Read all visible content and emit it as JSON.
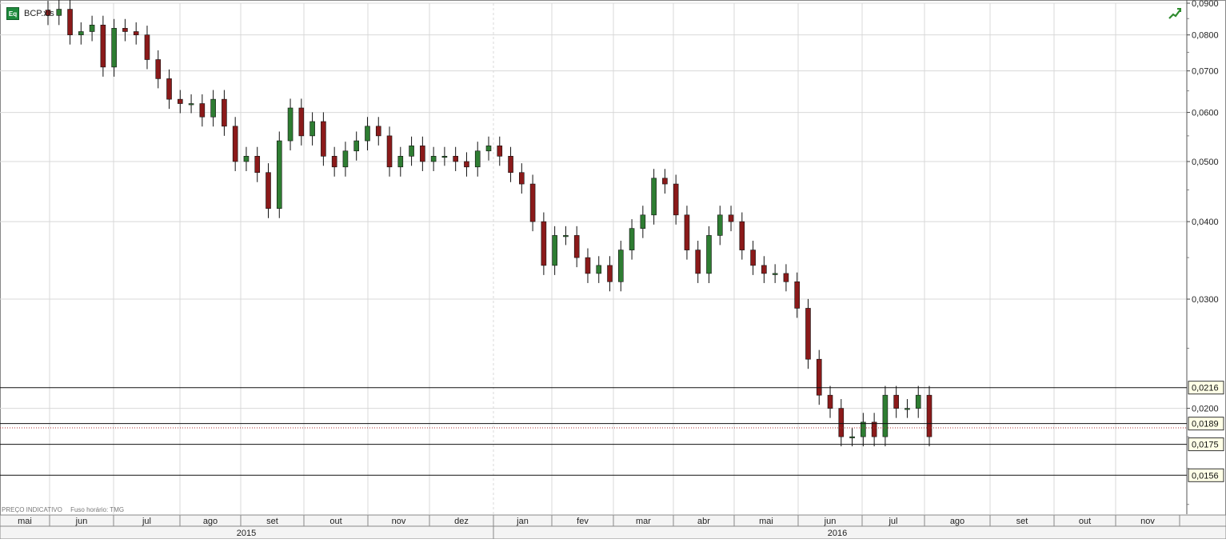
{
  "window": {
    "tab_label": "BCP.xls",
    "tab_icon": "eq-icon"
  },
  "footer": {
    "price_type": "PREÇO INDICATIVO",
    "timezone": "Fuso horário: TMG"
  },
  "toolbar": {
    "trend_icon": "trend-chart-icon"
  },
  "chart_data": {
    "type": "candlestick",
    "y_scale": "log",
    "ylim": [
      0.0135,
      0.09
    ],
    "y_ticks": [
      "0,0900",
      "0,0800",
      "0,0700",
      "0,0600",
      "0,0500",
      "0,0400",
      "0,0300",
      "0,0200"
    ],
    "y_tick_values": [
      0.09,
      0.08,
      0.07,
      0.06,
      0.05,
      0.04,
      0.03,
      0.02
    ],
    "months": [
      "mai",
      "jun",
      "jul",
      "ago",
      "set",
      "out",
      "nov",
      "dez",
      "jan",
      "fev",
      "mar",
      "abr",
      "mai",
      "jun",
      "jul",
      "ago",
      "set",
      "out",
      "nov"
    ],
    "years": [
      "2015",
      "2016"
    ],
    "horizontal_levels": [
      {
        "label": "0,0216",
        "value": 0.0216
      },
      {
        "label": "0,0189",
        "value": 0.0189
      },
      {
        "label": "0,0175",
        "value": 0.0175
      },
      {
        "label": "0,0156",
        "value": 0.0156
      }
    ],
    "last_price_line": 0.0186,
    "colors": {
      "up": "#2e7d32",
      "down": "#8b1a1a",
      "wick": "#111111",
      "grid": "#d8d8d8"
    },
    "weekly_closes": [
      0.086,
      0.088,
      0.08,
      0.081,
      0.083,
      0.071,
      0.082,
      0.081,
      0.08,
      0.073,
      0.068,
      0.063,
      0.062,
      0.062,
      0.059,
      0.063,
      0.057,
      0.05,
      0.051,
      0.048,
      0.042,
      0.054,
      0.061,
      0.055,
      0.058,
      0.051,
      0.049,
      0.052,
      0.054,
      0.057,
      0.055,
      0.049,
      0.051,
      0.053,
      0.05,
      0.051,
      0.051,
      0.05,
      0.049,
      0.052,
      0.053,
      0.051,
      0.048,
      0.046,
      0.04,
      0.034,
      0.038,
      0.038,
      0.035,
      0.033,
      0.034,
      0.032,
      0.036,
      0.039,
      0.041,
      0.047,
      0.046,
      0.041,
      0.036,
      0.033,
      0.038,
      0.041,
      0.04,
      0.036,
      0.034,
      0.033,
      0.033,
      0.032,
      0.029,
      0.024,
      0.021,
      0.02,
      0.018,
      0.018,
      0.019,
      0.018,
      0.021,
      0.02,
      0.02,
      0.021,
      0.018
    ]
  }
}
